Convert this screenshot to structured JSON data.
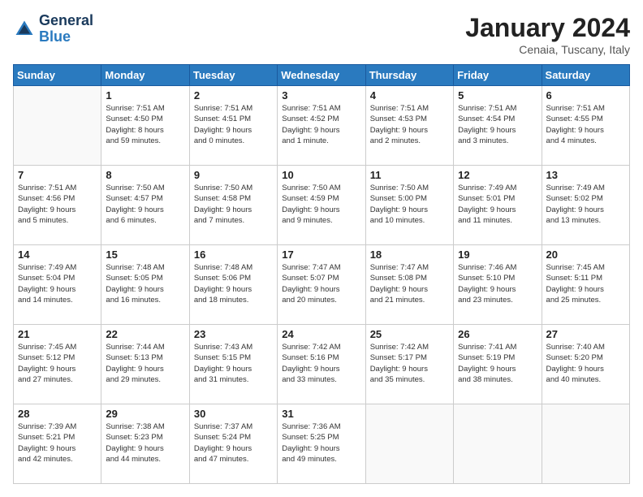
{
  "header": {
    "logo_general": "General",
    "logo_blue": "Blue",
    "title": "January 2024",
    "subtitle": "Cenaia, Tuscany, Italy"
  },
  "calendar": {
    "days_of_week": [
      "Sunday",
      "Monday",
      "Tuesday",
      "Wednesday",
      "Thursday",
      "Friday",
      "Saturday"
    ],
    "weeks": [
      [
        {
          "day": "",
          "info": ""
        },
        {
          "day": "1",
          "info": "Sunrise: 7:51 AM\nSunset: 4:50 PM\nDaylight: 8 hours\nand 59 minutes."
        },
        {
          "day": "2",
          "info": "Sunrise: 7:51 AM\nSunset: 4:51 PM\nDaylight: 9 hours\nand 0 minutes."
        },
        {
          "day": "3",
          "info": "Sunrise: 7:51 AM\nSunset: 4:52 PM\nDaylight: 9 hours\nand 1 minute."
        },
        {
          "day": "4",
          "info": "Sunrise: 7:51 AM\nSunset: 4:53 PM\nDaylight: 9 hours\nand 2 minutes."
        },
        {
          "day": "5",
          "info": "Sunrise: 7:51 AM\nSunset: 4:54 PM\nDaylight: 9 hours\nand 3 minutes."
        },
        {
          "day": "6",
          "info": "Sunrise: 7:51 AM\nSunset: 4:55 PM\nDaylight: 9 hours\nand 4 minutes."
        }
      ],
      [
        {
          "day": "7",
          "info": "Sunrise: 7:51 AM\nSunset: 4:56 PM\nDaylight: 9 hours\nand 5 minutes."
        },
        {
          "day": "8",
          "info": "Sunrise: 7:50 AM\nSunset: 4:57 PM\nDaylight: 9 hours\nand 6 minutes."
        },
        {
          "day": "9",
          "info": "Sunrise: 7:50 AM\nSunset: 4:58 PM\nDaylight: 9 hours\nand 7 minutes."
        },
        {
          "day": "10",
          "info": "Sunrise: 7:50 AM\nSunset: 4:59 PM\nDaylight: 9 hours\nand 9 minutes."
        },
        {
          "day": "11",
          "info": "Sunrise: 7:50 AM\nSunset: 5:00 PM\nDaylight: 9 hours\nand 10 minutes."
        },
        {
          "day": "12",
          "info": "Sunrise: 7:49 AM\nSunset: 5:01 PM\nDaylight: 9 hours\nand 11 minutes."
        },
        {
          "day": "13",
          "info": "Sunrise: 7:49 AM\nSunset: 5:02 PM\nDaylight: 9 hours\nand 13 minutes."
        }
      ],
      [
        {
          "day": "14",
          "info": "Sunrise: 7:49 AM\nSunset: 5:04 PM\nDaylight: 9 hours\nand 14 minutes."
        },
        {
          "day": "15",
          "info": "Sunrise: 7:48 AM\nSunset: 5:05 PM\nDaylight: 9 hours\nand 16 minutes."
        },
        {
          "day": "16",
          "info": "Sunrise: 7:48 AM\nSunset: 5:06 PM\nDaylight: 9 hours\nand 18 minutes."
        },
        {
          "day": "17",
          "info": "Sunrise: 7:47 AM\nSunset: 5:07 PM\nDaylight: 9 hours\nand 20 minutes."
        },
        {
          "day": "18",
          "info": "Sunrise: 7:47 AM\nSunset: 5:08 PM\nDaylight: 9 hours\nand 21 minutes."
        },
        {
          "day": "19",
          "info": "Sunrise: 7:46 AM\nSunset: 5:10 PM\nDaylight: 9 hours\nand 23 minutes."
        },
        {
          "day": "20",
          "info": "Sunrise: 7:45 AM\nSunset: 5:11 PM\nDaylight: 9 hours\nand 25 minutes."
        }
      ],
      [
        {
          "day": "21",
          "info": "Sunrise: 7:45 AM\nSunset: 5:12 PM\nDaylight: 9 hours\nand 27 minutes."
        },
        {
          "day": "22",
          "info": "Sunrise: 7:44 AM\nSunset: 5:13 PM\nDaylight: 9 hours\nand 29 minutes."
        },
        {
          "day": "23",
          "info": "Sunrise: 7:43 AM\nSunset: 5:15 PM\nDaylight: 9 hours\nand 31 minutes."
        },
        {
          "day": "24",
          "info": "Sunrise: 7:42 AM\nSunset: 5:16 PM\nDaylight: 9 hours\nand 33 minutes."
        },
        {
          "day": "25",
          "info": "Sunrise: 7:42 AM\nSunset: 5:17 PM\nDaylight: 9 hours\nand 35 minutes."
        },
        {
          "day": "26",
          "info": "Sunrise: 7:41 AM\nSunset: 5:19 PM\nDaylight: 9 hours\nand 38 minutes."
        },
        {
          "day": "27",
          "info": "Sunrise: 7:40 AM\nSunset: 5:20 PM\nDaylight: 9 hours\nand 40 minutes."
        }
      ],
      [
        {
          "day": "28",
          "info": "Sunrise: 7:39 AM\nSunset: 5:21 PM\nDaylight: 9 hours\nand 42 minutes."
        },
        {
          "day": "29",
          "info": "Sunrise: 7:38 AM\nSunset: 5:23 PM\nDaylight: 9 hours\nand 44 minutes."
        },
        {
          "day": "30",
          "info": "Sunrise: 7:37 AM\nSunset: 5:24 PM\nDaylight: 9 hours\nand 47 minutes."
        },
        {
          "day": "31",
          "info": "Sunrise: 7:36 AM\nSunset: 5:25 PM\nDaylight: 9 hours\nand 49 minutes."
        },
        {
          "day": "",
          "info": ""
        },
        {
          "day": "",
          "info": ""
        },
        {
          "day": "",
          "info": ""
        }
      ]
    ]
  }
}
